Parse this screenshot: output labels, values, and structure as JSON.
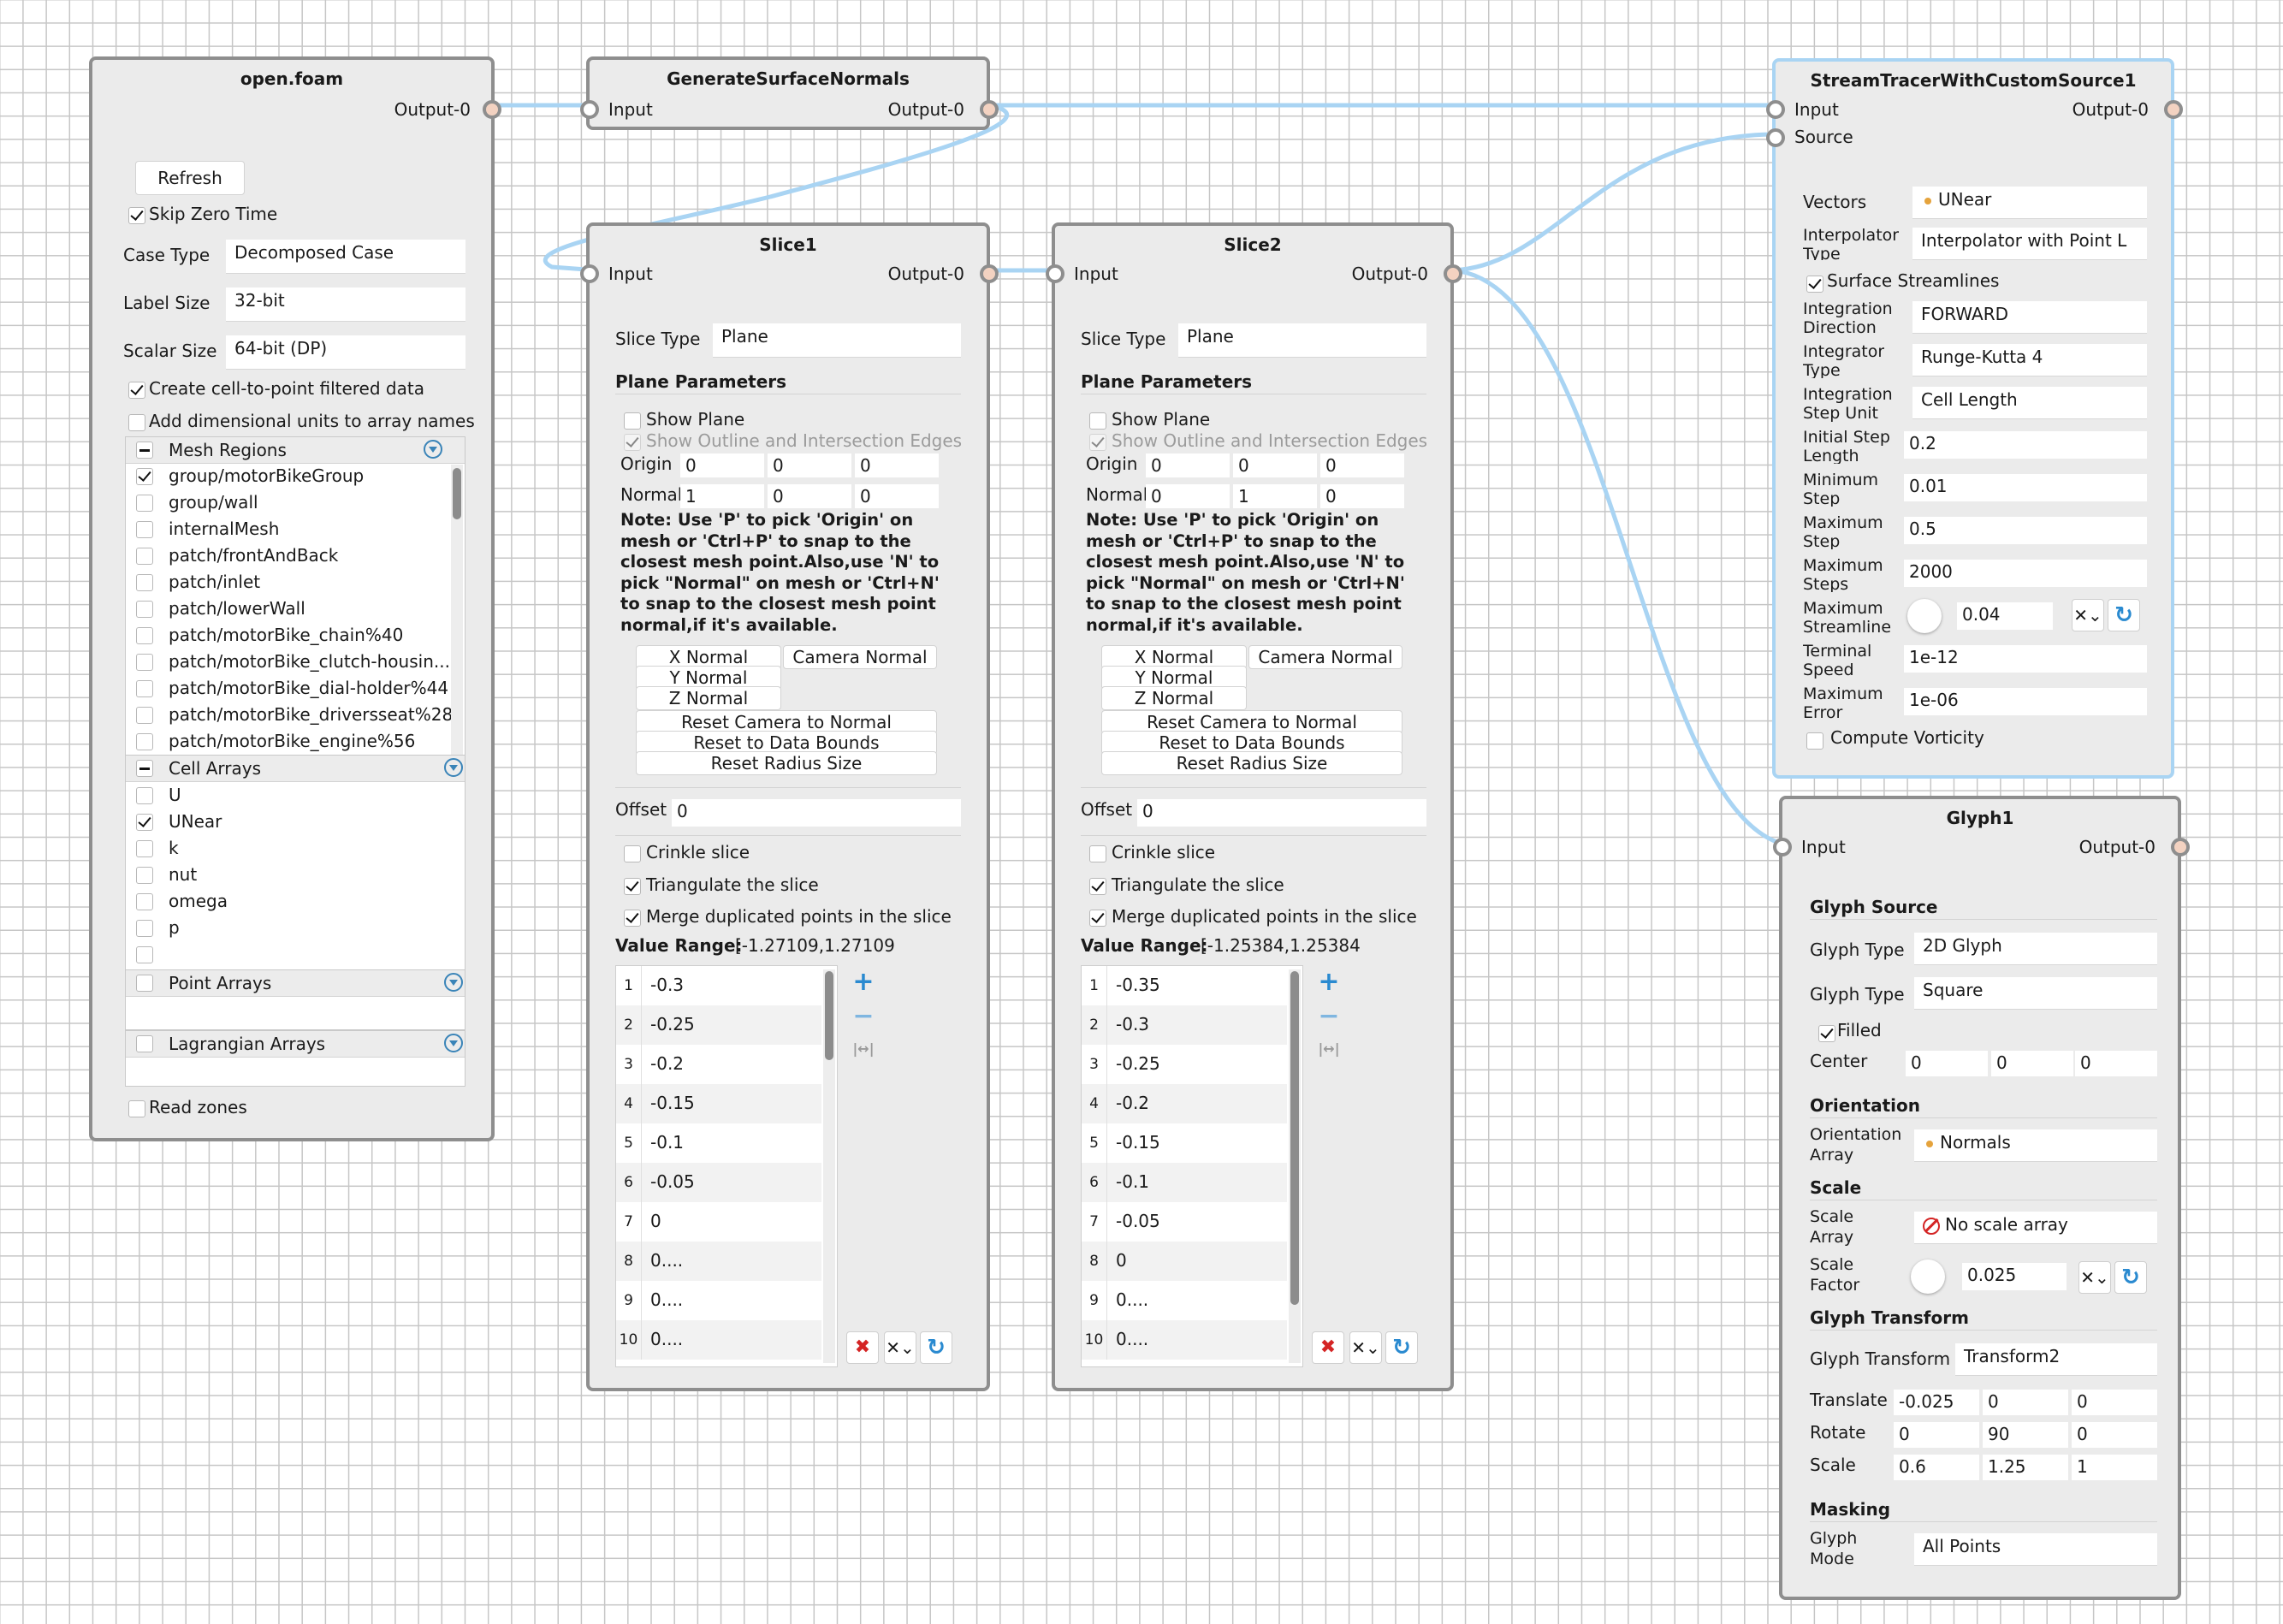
{
  "colors": {
    "grid": "#c6c6c6",
    "node_bg": "#ebebeb",
    "node_border": "#8e8e8e",
    "selected_border": "#a9d4f3",
    "link": "#a9d4f3",
    "output_port": "#f3d2c1"
  },
  "open_foam": {
    "title": "open.foam",
    "output": "Output-0",
    "refresh": "Refresh",
    "skip_zero_time": "Skip Zero Time",
    "case_type_label": "Case Type",
    "case_type": "Decomposed Case",
    "label_size_label": "Label Size",
    "label_size": "32-bit",
    "scalar_size_label": "Scalar Size",
    "scalar_size": "64-bit (DP)",
    "create_cell_to_point": "Create cell-to-point filtered data",
    "add_dimensional_units": "Add dimensional units to array names",
    "mesh_regions": {
      "header": "Mesh Regions",
      "items": [
        {
          "label": "group/motorBikeGroup",
          "checked": true
        },
        {
          "label": "group/wall",
          "checked": false
        },
        {
          "label": "internalMesh",
          "checked": false
        },
        {
          "label": "patch/frontAndBack",
          "checked": false
        },
        {
          "label": "patch/inlet",
          "checked": false
        },
        {
          "label": "patch/lowerWall",
          "checked": false
        },
        {
          "label": "patch/motorBike_chain%40",
          "checked": false
        },
        {
          "label": "patch/motorBike_clutch-housin...",
          "checked": false
        },
        {
          "label": "patch/motorBike_dial-holder%44",
          "checked": false
        },
        {
          "label": "patch/motorBike_driversseat%28",
          "checked": false
        },
        {
          "label": "patch/motorBike_engine%56",
          "checked": false
        }
      ]
    },
    "cell_arrays": {
      "header": "Cell Arrays",
      "items": [
        {
          "label": "U",
          "checked": false
        },
        {
          "label": "UNear",
          "checked": true
        },
        {
          "label": "k",
          "checked": false
        },
        {
          "label": "nut",
          "checked": false
        },
        {
          "label": "omega",
          "checked": false
        },
        {
          "label": "p",
          "checked": false
        }
      ]
    },
    "point_arrays": "Point Arrays",
    "lagrangian_arrays": "Lagrangian Arrays",
    "read_zones": "Read zones"
  },
  "gsn": {
    "title": "GenerateSurfaceNormals",
    "input": "Input",
    "output": "Output-0"
  },
  "slice1": {
    "title": "Slice1",
    "input": "Input",
    "output": "Output-0",
    "slice_type_label": "Slice Type",
    "slice_type": "Plane",
    "plane_parameters": "Plane Parameters",
    "show_plane": "Show Plane",
    "show_outline": "Show Outline and Intersection Edges",
    "origin_label": "Origin",
    "origin": [
      "0",
      "0",
      "0"
    ],
    "normal_label": "Normal",
    "normal": [
      "1",
      "0",
      "0"
    ],
    "note": "Note: Use 'P' to pick 'Origin' on mesh or 'Ctrl+P' to snap to the closest mesh point.Also,use 'N' to pick \"Normal\" on mesh or 'Ctrl+N' to snap to the closest mesh point normal,if it's available.",
    "x_normal": "X Normal",
    "y_normal": "Y Normal",
    "z_normal": "Z Normal",
    "camera_normal": "Camera Normal",
    "reset_camera": "Reset Camera to Normal",
    "reset_bounds": "Reset to Data Bounds",
    "reset_radius": "Reset Radius Size",
    "offset_label": "Offset",
    "offset": "0",
    "crinkle": "Crinkle slice",
    "triangulate": "Triangulate the slice",
    "merge": "Merge duplicated points in the slice",
    "value_range_label": "Value Range:",
    "value_range": "[-1.27109,1.27109",
    "values": [
      {
        "n": "1",
        "v": "-0.3"
      },
      {
        "n": "2",
        "v": "-0.25"
      },
      {
        "n": "3",
        "v": "-0.2"
      },
      {
        "n": "4",
        "v": "-0.15"
      },
      {
        "n": "5",
        "v": "-0.1"
      },
      {
        "n": "6",
        "v": "-0.05"
      },
      {
        "n": "7",
        "v": "0"
      },
      {
        "n": "8",
        "v": "0...."
      },
      {
        "n": "9",
        "v": "0...."
      },
      {
        "n": "10",
        "v": "0...."
      }
    ]
  },
  "slice2": {
    "title": "Slice2",
    "input": "Input",
    "output": "Output-0",
    "slice_type_label": "Slice Type",
    "slice_type": "Plane",
    "plane_parameters": "Plane Parameters",
    "show_plane": "Show Plane",
    "show_outline": "Show Outline and Intersection Edges",
    "origin_label": "Origin",
    "origin": [
      "0",
      "0",
      "0"
    ],
    "normal_label": "Normal",
    "normal": [
      "0",
      "1",
      "0"
    ],
    "note": "Note: Use 'P' to pick 'Origin' on mesh or 'Ctrl+P' to snap to the closest mesh point.Also,use 'N' to pick \"Normal\" on mesh or 'Ctrl+N' to snap to the closest mesh point normal,if it's available.",
    "x_normal": "X Normal",
    "y_normal": "Y Normal",
    "z_normal": "Z Normal",
    "camera_normal": "Camera Normal",
    "reset_camera": "Reset Camera to Normal",
    "reset_bounds": "Reset to Data Bounds",
    "reset_radius": "Reset Radius Size",
    "offset_label": "Offset",
    "offset": "0",
    "crinkle": "Crinkle slice",
    "triangulate": "Triangulate the slice",
    "merge": "Merge duplicated points in the slice",
    "value_range_label": "Value Range:",
    "value_range": "[-1.25384,1.25384",
    "values": [
      {
        "n": "1",
        "v": "-0.35"
      },
      {
        "n": "2",
        "v": "-0.3"
      },
      {
        "n": "3",
        "v": "-0.25"
      },
      {
        "n": "4",
        "v": "-0.2"
      },
      {
        "n": "5",
        "v": "-0.15"
      },
      {
        "n": "6",
        "v": "-0.1"
      },
      {
        "n": "7",
        "v": "-0.05"
      },
      {
        "n": "8",
        "v": "0"
      },
      {
        "n": "9",
        "v": "0...."
      },
      {
        "n": "10",
        "v": "0...."
      }
    ]
  },
  "stream": {
    "title": "StreamTracerWithCustomSource1",
    "input": "Input",
    "source": "Source",
    "output": "Output-0",
    "vectors_label": "Vectors",
    "vectors": "UNear",
    "interp_label1": "Interpolator",
    "interp_label2": "Type",
    "interp": "Interpolator with Point L",
    "surface_streamlines": "Surface Streamlines",
    "integ_dir_label1": "Integration",
    "integ_dir_label2": "Direction",
    "integ_dir": "FORWARD",
    "integ_type_label1": "Integrator",
    "integ_type_label2": "Type",
    "integ_type": "Runge-Kutta 4",
    "step_unit_label1": "Integration",
    "step_unit_label2": "Step Unit",
    "step_unit": "Cell Length",
    "init_step_label1": "Initial Step",
    "init_step_label2": "Length",
    "init_step": "0.2",
    "min_step_label1": "Minimum",
    "min_step_label2": "Step",
    "min_step": "0.01",
    "max_step_label1": "Maximum",
    "max_step_label2": "Step",
    "max_step": "0.5",
    "max_steps_label1": "Maximum",
    "max_steps_label2": "Steps",
    "max_steps": "2000",
    "max_len_label1": "Maximum",
    "max_len_label2": "Streamline",
    "max_len": "0.04",
    "term_speed_label1": "Terminal",
    "term_speed_label2": "Speed",
    "term_speed": "1e-12",
    "max_err_label1": "Maximum",
    "max_err_label2": "Error",
    "max_err": "1e-06",
    "vorticity": "Compute Vorticity"
  },
  "glyph": {
    "title": "Glyph1",
    "input": "Input",
    "output": "Output-0",
    "glyph_source": "Glyph Source",
    "glyph_type_label": "Glyph Type",
    "glyph_type": "2D Glyph",
    "glyph_type2": "Square",
    "filled": "Filled",
    "center_label": "Center",
    "center": [
      "0",
      "0",
      "0"
    ],
    "orientation": "Orientation",
    "orient_label1": "Orientation",
    "orient_label2": "Array",
    "orient_array": "Normals",
    "scale": "Scale",
    "scale_array_label1": "Scale",
    "scale_array_label2": "Array",
    "scale_array": "No scale array",
    "scale_factor_label1": "Scale",
    "scale_factor_label2": "Factor",
    "scale_factor": "0.025",
    "glyph_transform": "Glyph Transform",
    "glyph_transform_label": "Glyph Transform",
    "glyph_transform_value": "Transform2",
    "translate_label": "Translate",
    "translate": [
      "-0.025",
      "0",
      "0"
    ],
    "rotate_label": "Rotate",
    "rotate": [
      "0",
      "90",
      "0"
    ],
    "scale_label": "Scale",
    "scale_vals": [
      "0.6",
      "1.25",
      "1"
    ],
    "masking": "Masking",
    "glyph_mode_label1": "Glyph",
    "glyph_mode_label2": "Mode",
    "glyph_mode": "All Points"
  }
}
